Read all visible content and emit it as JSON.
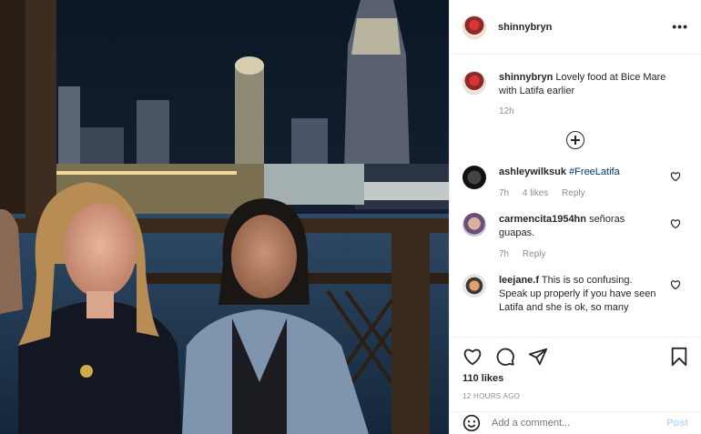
{
  "post": {
    "username": "shinnybryn",
    "caption": "Lovely food at Bice Mare with Latifa earlier",
    "caption_time": "12h"
  },
  "comments": [
    {
      "username": "ashleywilksuk",
      "text": "#FreeLatifa",
      "time": "7h",
      "likes": "4 likes",
      "reply": "Reply"
    },
    {
      "username": "carmencita1954hn",
      "text": "señoras guapas.",
      "time": "7h",
      "reply": "Reply"
    },
    {
      "username": "leejane.f",
      "text": "This is so confusing. Speak up properly if you have seen Latifa and she is ok, so many"
    }
  ],
  "likes_count": "110 likes",
  "post_time": "12 HOURS AGO",
  "add_comment": {
    "placeholder": "Add a comment...",
    "post_label": "Post"
  },
  "icons": {
    "more": "more-options-icon",
    "load_more": "plus-circle-icon",
    "like": "heart-icon",
    "comment": "comment-icon",
    "share": "share-icon",
    "save": "bookmark-icon",
    "emoji": "emoji-icon"
  },
  "colors": {
    "link": "#00376b",
    "muted": "#8e8e8e",
    "post_button": "#b2dffc"
  }
}
